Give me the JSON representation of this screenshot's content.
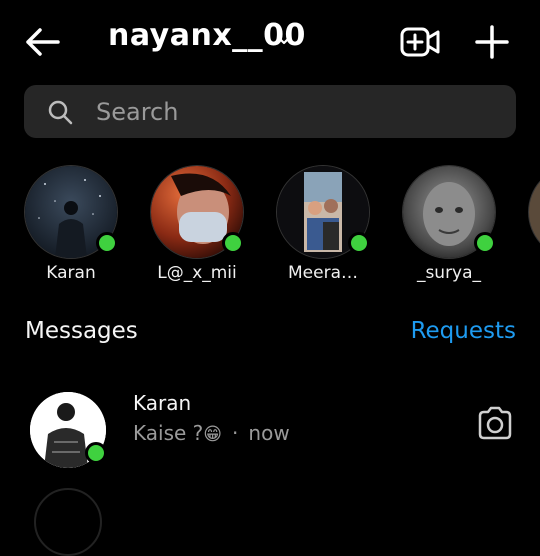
{
  "header": {
    "username": "nayanx__00"
  },
  "search": {
    "placeholder": "Search"
  },
  "stories": [
    {
      "name": "Karan"
    },
    {
      "name": "L@_x_mii"
    },
    {
      "name": "Meera…"
    },
    {
      "name": "_surya_"
    }
  ],
  "messages": {
    "label": "Messages",
    "requests_label": "Requests",
    "items": [
      {
        "name": "Karan",
        "preview": "Kaise ?",
        "emoji": "😁",
        "time": "now"
      }
    ]
  },
  "colors": {
    "online": "#3fd13f",
    "link": "#1e9bf0",
    "search_bg": "#262626"
  }
}
